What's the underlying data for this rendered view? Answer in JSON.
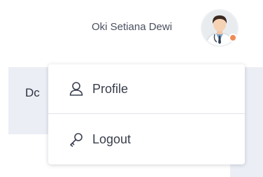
{
  "header": {
    "user_name": "Oki Setiana Dewi",
    "status_color": "#f08a55"
  },
  "background": {
    "partial_text": "Dc"
  },
  "dropdown": {
    "items": [
      {
        "label": "Profile",
        "icon": "user-icon"
      },
      {
        "label": "Logout",
        "icon": "key-icon"
      }
    ]
  }
}
